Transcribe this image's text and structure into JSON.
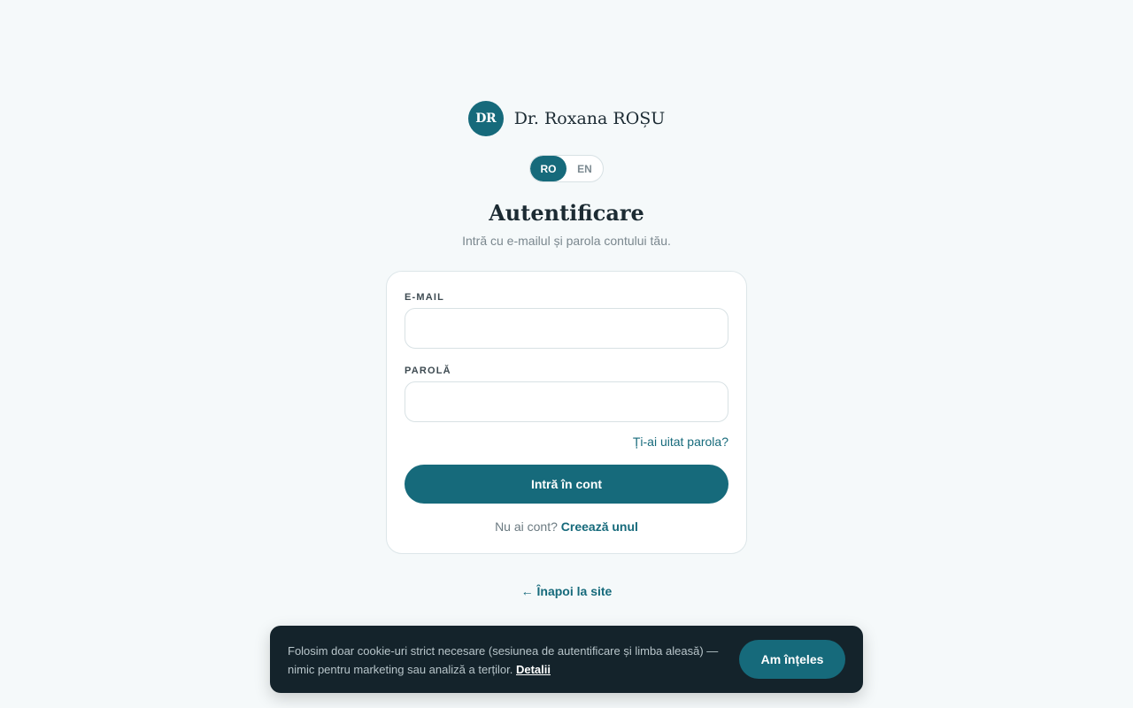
{
  "brand": {
    "initials": "DR",
    "name": "Dr. Roxana ROȘU"
  },
  "language": {
    "options": [
      "RO",
      "EN"
    ],
    "active": "RO"
  },
  "header": {
    "title": "Autentificare",
    "subtitle": "Intră cu e-mailul și parola contului tău."
  },
  "form": {
    "email_label": "E-MAIL",
    "email_value": "",
    "password_label": "PAROLĂ",
    "password_value": "",
    "forgot_label": "Ți-ai uitat parola?",
    "submit_label": "Intră în cont",
    "signup_prompt": "Nu ai cont?",
    "signup_link": "Creează unul"
  },
  "back_link": "← Înapoi la site",
  "cookie": {
    "text": "Folosim doar cookie-uri strict necesare (sesiunea de autentificare și limba aleasă) — nimic pentru marketing sau analiză a terților.",
    "details_link": "Detalii",
    "accept_label": "Am înțeles"
  },
  "colors": {
    "accent": "#166a7b",
    "background": "#f5f9fa",
    "cookie_bg": "#14232b"
  }
}
